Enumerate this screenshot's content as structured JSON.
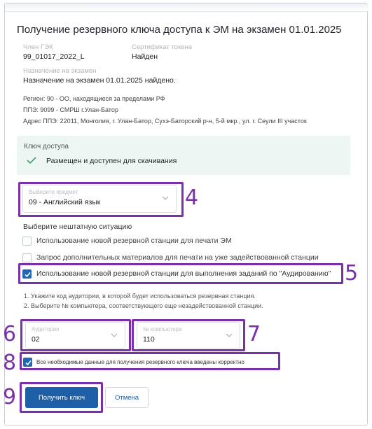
{
  "dialog": {
    "title": "Получение резервного ключа доступа к ЭМ на экзамен 01.01.2025"
  },
  "member": {
    "label": "Член ГЭК",
    "value": "99_01017_2022_L"
  },
  "certificate": {
    "label": "Сертификат токена",
    "value": "Найден"
  },
  "assignment": {
    "label": "Назначение на экзамен",
    "value": "Назначение на экзамен 01.01.2025 найдено."
  },
  "location": {
    "region": "Регион: 90 - ОО, находящиеся за пределами РФ",
    "ppe": "ППЭ: 9099 - СМРШ г.Улан-Батор",
    "address": "Адрес ППЭ: 22011, Монголия, г. Улан-Батор, Сухэ-Баторский р-н, 5-й мкр., ул. г. Сеули III участок"
  },
  "access_key": {
    "header": "Ключ доступа",
    "status": "Размещен и доступен для скачивания",
    "status_color": "#3aa06a"
  },
  "subject_select": {
    "label": "Выберите предмет",
    "value": "09 - Английский язык"
  },
  "situation": {
    "title": "Выберите нештатную ситуацию",
    "options": [
      {
        "label": "Использование новой резервной станции для печати ЭМ",
        "checked": false
      },
      {
        "label": "Запрос дополнительных материалов для печати на уже задействованной станции",
        "checked": false
      },
      {
        "label": "Использование новой резервной станции для выполнения заданий по \"Аудированию\"",
        "checked": true
      }
    ]
  },
  "instructions": [
    "1. Укажите код аудитории, в которой будет использоваться резервная станция.",
    "2. Выберите № компьютера, соответствующего еще незадействованной станции."
  ],
  "auditorium_select": {
    "label": "Аудитория",
    "value": "02"
  },
  "computer_select": {
    "label": "№ компьютера",
    "value": "110"
  },
  "confirm": {
    "label": "Все необходимые данные для получения резервного ключа введены корректно",
    "checked": true
  },
  "buttons": {
    "get_key": "Получить ключ",
    "cancel": "Отмена"
  },
  "annotations": {
    "color": "#7b2fa8",
    "n4": "4",
    "n5": "5",
    "n6": "6",
    "n7": "7",
    "n8": "8",
    "n9": "9"
  },
  "colors": {
    "primary": "#1f5fa8",
    "highlight": "#7b2fa8"
  }
}
